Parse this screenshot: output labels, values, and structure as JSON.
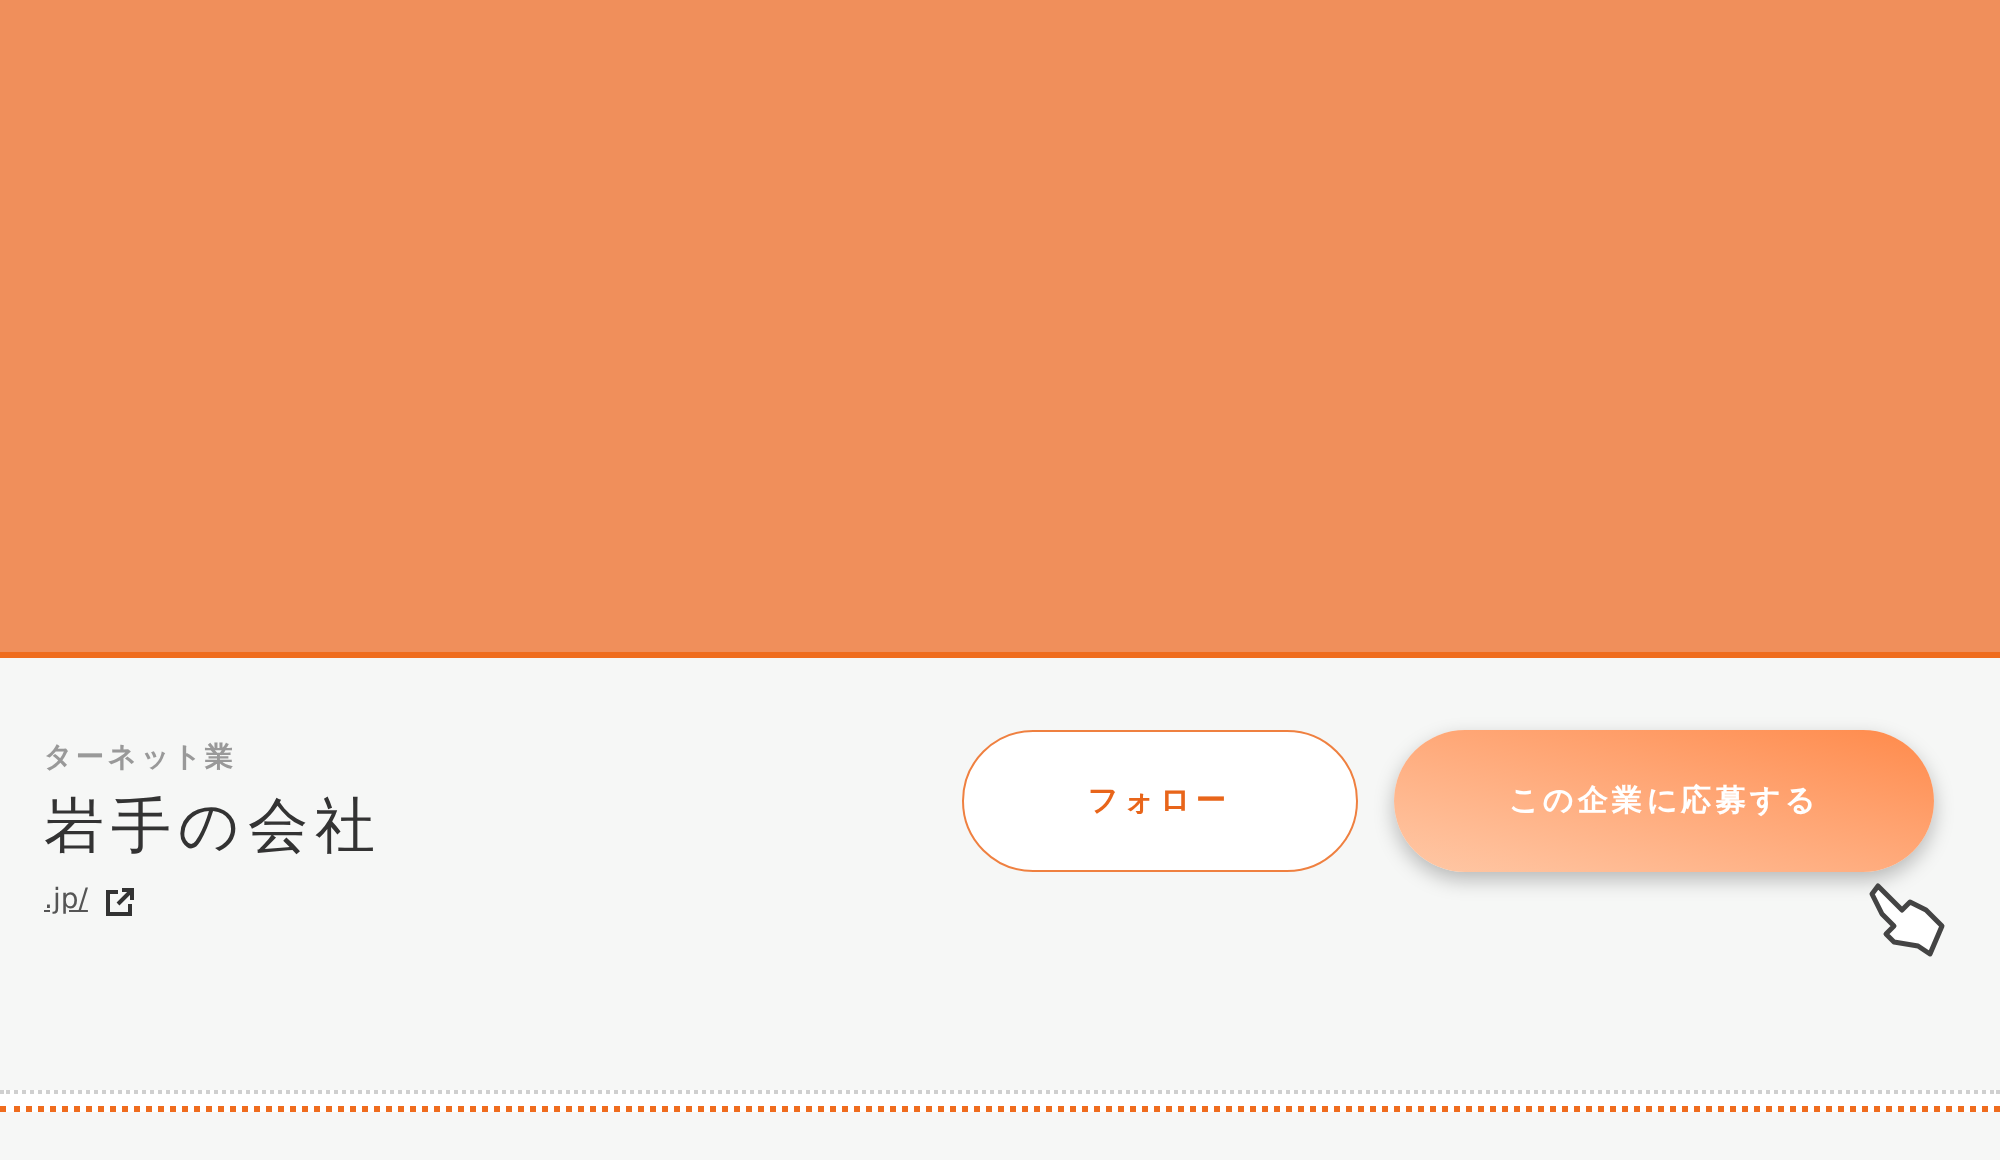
{
  "company": {
    "category": "ターネット業",
    "name": "岩手の会社",
    "url": ".jp/"
  },
  "buttons": [
    {
      "kind": "outline",
      "label": "フォロー"
    },
    {
      "kind": "primary",
      "label": "この企業に応募する"
    }
  ]
}
